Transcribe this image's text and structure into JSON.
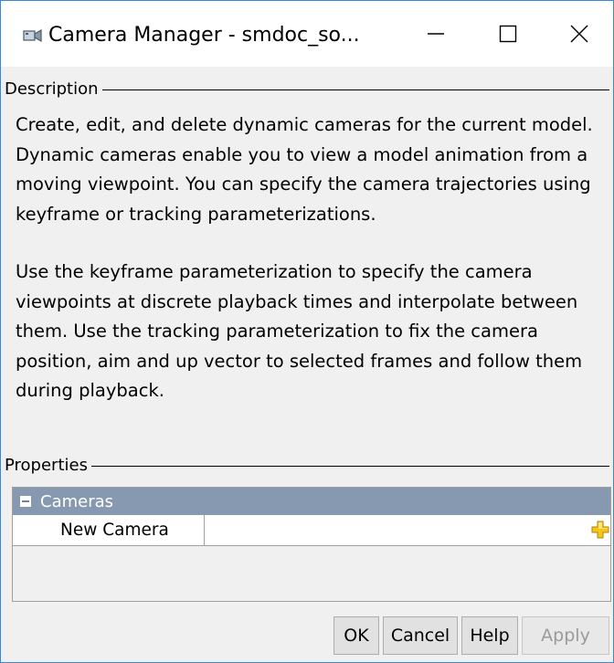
{
  "window": {
    "title": "Camera Manager - smdoc_so...",
    "minimize_glyph": "—",
    "maximize_glyph": "☐",
    "close_glyph": "✕",
    "accent_border": "#3a87d8"
  },
  "description_group": {
    "label": "Description",
    "paragraphs": [
      "Create, edit, and delete dynamic cameras for the current model. Dynamic cameras enable you to view a model animation from a moving viewpoint. You can specify the camera trajectories using keyframe or tracking parameterizations.",
      "Use the keyframe parameterization to specify the camera viewpoints at discrete playback times and interpolate between them. Use the tracking parameterization to fix the camera position, aim and up vector to selected frames and follow them during playback."
    ]
  },
  "properties_group": {
    "label": "Properties",
    "category": "Cameras",
    "rows": [
      {
        "name": "New Camera",
        "value": ""
      }
    ],
    "header_color": "#8699b0",
    "add_icon_color": "#f0c020"
  },
  "buttons": {
    "ok": "OK",
    "cancel": "Cancel",
    "help": "Help",
    "apply": "Apply"
  }
}
